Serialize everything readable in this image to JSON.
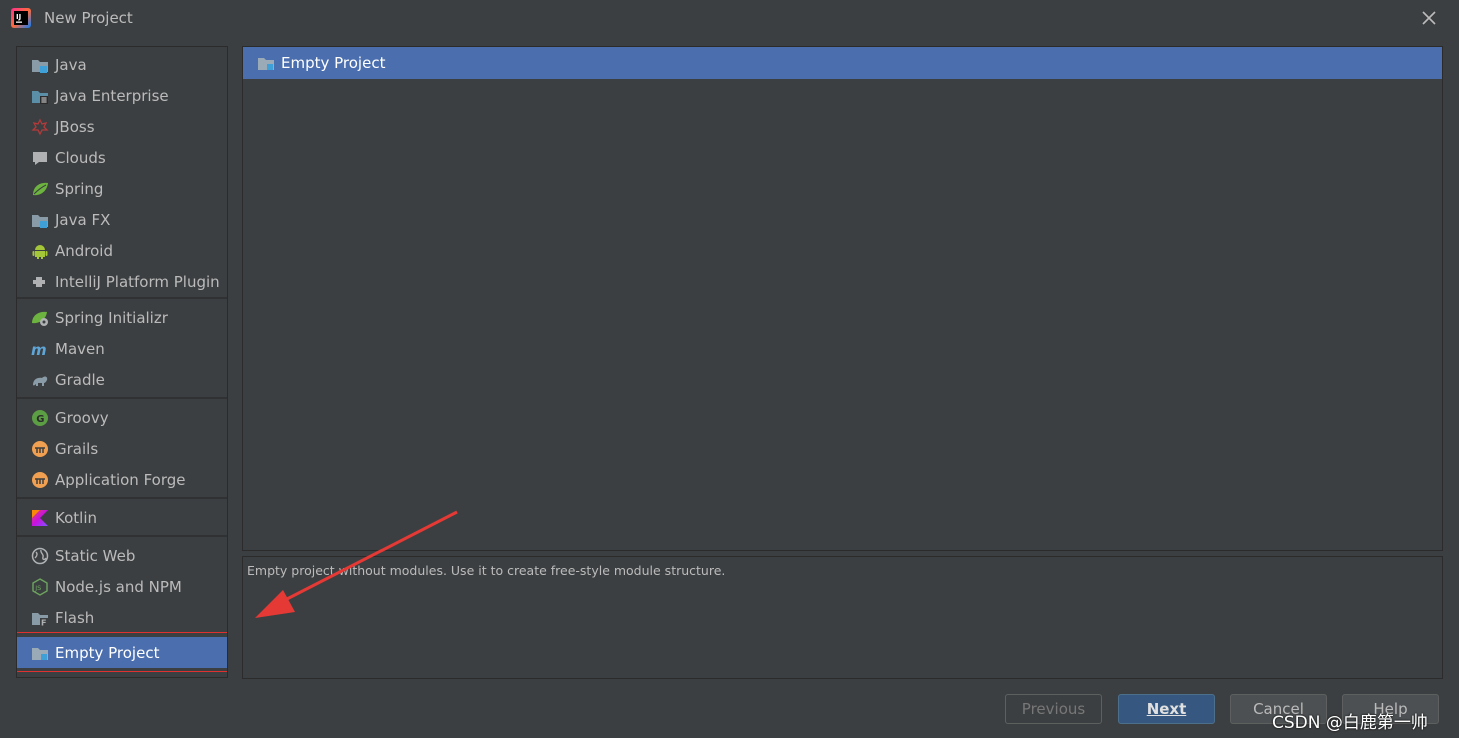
{
  "window": {
    "title": "New Project"
  },
  "sidebar": {
    "groups": [
      [
        {
          "label": "Java",
          "icon": "java-folder-icon"
        },
        {
          "label": "Java Enterprise",
          "icon": "java-enterprise-icon"
        },
        {
          "label": "JBoss",
          "icon": "jboss-icon"
        },
        {
          "label": "Clouds",
          "icon": "clouds-icon"
        },
        {
          "label": "Spring",
          "icon": "spring-leaf-icon"
        },
        {
          "label": "Java FX",
          "icon": "javafx-folder-icon"
        },
        {
          "label": "Android",
          "icon": "android-icon"
        },
        {
          "label": "IntelliJ Platform Plugin",
          "icon": "plugin-icon"
        }
      ],
      [
        {
          "label": "Spring Initializr",
          "icon": "spring-initializr-icon"
        },
        {
          "label": "Maven",
          "icon": "maven-icon"
        },
        {
          "label": "Gradle",
          "icon": "gradle-elephant-icon"
        }
      ],
      [
        {
          "label": "Groovy",
          "icon": "groovy-icon"
        },
        {
          "label": "Grails",
          "icon": "grails-icon"
        },
        {
          "label": "Application Forge",
          "icon": "application-forge-icon"
        }
      ],
      [
        {
          "label": "Kotlin",
          "icon": "kotlin-icon"
        }
      ],
      [
        {
          "label": "Static Web",
          "icon": "globe-icon"
        },
        {
          "label": "Node.js and NPM",
          "icon": "nodejs-icon"
        },
        {
          "label": "Flash",
          "icon": "flash-folder-icon"
        },
        {
          "label": "Empty Project",
          "icon": "empty-project-folder-icon",
          "selected": true
        }
      ]
    ]
  },
  "main": {
    "selected_template": "Empty Project",
    "description": "Empty project without modules. Use it to create free-style module structure."
  },
  "buttons": {
    "previous": "Previous",
    "next": "Next",
    "cancel": "Cancel",
    "help": "Help"
  },
  "watermark": "CSDN @白鹿第一帅",
  "colors": {
    "background": "#3c3f41",
    "selection": "#4b6eaf",
    "highlight_border": "#e03131",
    "arrow": "#e53935"
  }
}
